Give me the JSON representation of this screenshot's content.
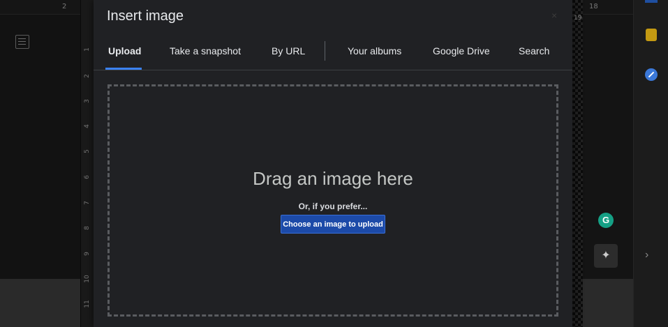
{
  "dialog": {
    "title": "Insert image",
    "close_label": "×"
  },
  "tabs": [
    {
      "label": "Upload",
      "active": true
    },
    {
      "label": "Take a snapshot",
      "active": false
    },
    {
      "label": "By URL",
      "active": false
    },
    {
      "label": "Your albums",
      "active": false
    },
    {
      "label": "Google Drive",
      "active": false
    },
    {
      "label": "Search",
      "active": false
    }
  ],
  "upload": {
    "drag_text": "Drag an image here",
    "prefer_text": "Or, if you prefer...",
    "button_label": "Choose an image to upload"
  },
  "background": {
    "top_ruler_left": "2",
    "top_ruler_right": "18",
    "top_ruler_right_edge": "19",
    "vertical_ruler": [
      "1",
      "2",
      "3",
      "4",
      "5",
      "6",
      "7",
      "8",
      "9",
      "10",
      "11"
    ],
    "chevron": "›",
    "grammarly_letter": "G",
    "explore_glyph": "✦"
  },
  "colors": {
    "accent": "#3b82f6",
    "button_bg": "#1c4aa8",
    "dialog_bg": "#202124"
  }
}
